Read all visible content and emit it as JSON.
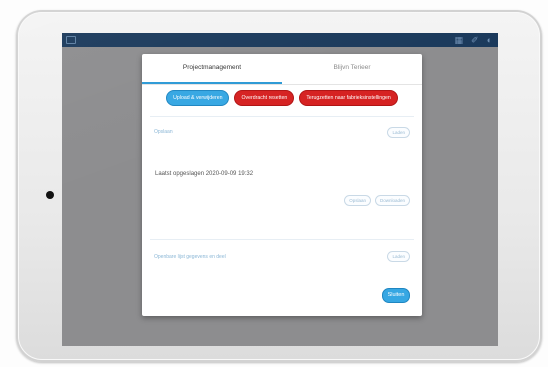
{
  "statusbar": {
    "right_icons": [
      "▦",
      "✐",
      "◐"
    ]
  },
  "dialog": {
    "tabs": [
      {
        "label": "Projectmanagement",
        "active": true
      },
      {
        "label": "Blijvn Terieer",
        "active": false
      }
    ],
    "actions": [
      {
        "label": "Upload & verwijderen",
        "color": "#36a7e3"
      },
      {
        "label": "Overdracht resetten",
        "color": "#d62222"
      },
      {
        "label": "Terugzetten naar fabrieksinstellingen",
        "color": "#d62222"
      }
    ],
    "section1": {
      "label": "Opslaan",
      "button": "Laden",
      "last_upload": "Laatst opgeslagen 2020-09-09 19:32",
      "button_a": "Opslaan",
      "button_b": "Downloaden"
    },
    "section2": {
      "label": "Openbare lijst gegevens en deel",
      "button": "Laden"
    },
    "close_label": "Sluiten"
  }
}
